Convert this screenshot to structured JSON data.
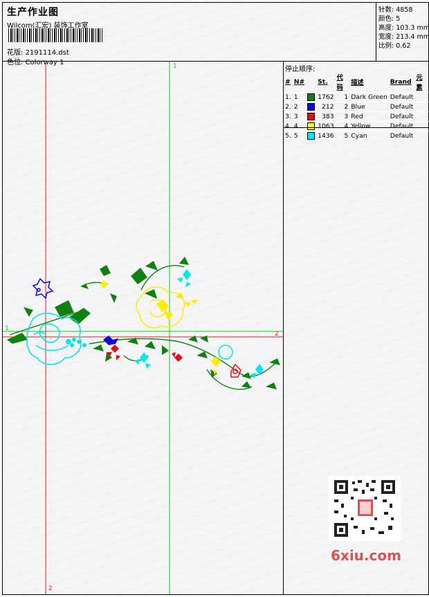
{
  "header": {
    "title": "生产作业图",
    "studio": "Wilcom(汇宏) 装饰工作室",
    "design_label": "花版:",
    "design_file": "2191114.dst",
    "colorway_label": "色位:",
    "colorway": "Colorway 1"
  },
  "stats": [
    {
      "label": "针数:",
      "value": "4858"
    },
    {
      "label": "颜色:",
      "value": "5"
    },
    {
      "label": "高度:",
      "value": "103.3 mm"
    },
    {
      "label": "宽度:",
      "value": "213.4 mm"
    },
    {
      "label": "比例:",
      "value": "0.62"
    }
  ],
  "stop_sequence": {
    "title": "停止顺序:",
    "columns": [
      "#",
      "N#",
      "St.",
      "代码",
      "描述",
      "Brand",
      "元素"
    ],
    "rows": [
      {
        "idx": "1.",
        "n": "1",
        "color": "#108010",
        "stitches": "1762",
        "code": "1",
        "desc": "Dark Green",
        "brand": "Default"
      },
      {
        "idx": "2.",
        "n": "2",
        "color": "#0a0ae0",
        "stitches": "212",
        "code": "2",
        "desc": "Blue",
        "brand": "Default"
      },
      {
        "idx": "3.",
        "n": "3",
        "color": "#e01010",
        "stitches": "383",
        "code": "3",
        "desc": "Red",
        "brand": "Default"
      },
      {
        "idx": "4.",
        "n": "4",
        "color": "#ffff00",
        "stitches": "1063",
        "code": "4",
        "desc": "Yellow",
        "brand": "Default"
      },
      {
        "idx": "5.",
        "n": "5",
        "color": "#00e8f0",
        "stitches": "1436",
        "code": "5",
        "desc": "Cyan",
        "brand": "Default"
      }
    ]
  },
  "axes": {
    "green_top": "1",
    "green_left": "1",
    "red_right": "2",
    "red_bottom": "2",
    "green_color": "#11cc11",
    "red_color": "#e02020"
  },
  "watermark": "6xiu.com",
  "qr_icon": "qr-code-icon"
}
